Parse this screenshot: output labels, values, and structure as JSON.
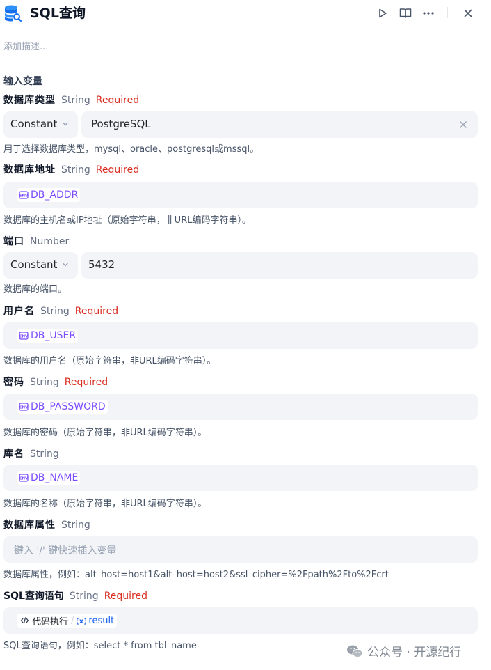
{
  "header": {
    "title": "SQL查询",
    "description_placeholder": "添加描述..."
  },
  "colors": {
    "accent": "#155eef",
    "required": "#d92d20",
    "env": "#7c4dff"
  },
  "section_title": "输入变量",
  "fields": {
    "db_type": {
      "name": "数据库类型",
      "type": "String",
      "required": "Required",
      "mode": "Constant",
      "value": "PostgreSQL",
      "help": "用于选择数据库类型，mysql、oracle、postgresql或mssql。"
    },
    "db_addr": {
      "name": "数据库地址",
      "type": "String",
      "required": "Required",
      "env_var": "DB_ADDR",
      "help": "数据库的主机名或IP地址（原始字符串，非URL编码字符串）。"
    },
    "port": {
      "name": "端口",
      "type": "Number",
      "mode": "Constant",
      "value": "5432",
      "help": "数据库的端口。"
    },
    "user": {
      "name": "用户名",
      "type": "String",
      "required": "Required",
      "env_var": "DB_USER",
      "help": "数据库的用户名（原始字符串，非URL编码字符串）。"
    },
    "password": {
      "name": "密码",
      "type": "String",
      "required": "Required",
      "env_var": "DB_PASSWORD",
      "help": "数据库的密码（原始字符串，非URL编码字符串）。"
    },
    "db_name": {
      "name": "库名",
      "type": "String",
      "env_var": "DB_NAME",
      "help": "数据库的名称（原始字符串，非URL编码字符串）。"
    },
    "db_props": {
      "name": "数据库属性",
      "type": "String",
      "placeholder": "键入 '/' 键快速插入变量",
      "help": "数据库属性，例如：alt_host=host1&alt_host=host2&ssl_cipher=%2Fpath%2Fto%2Fcrt"
    },
    "sql": {
      "name": "SQL查询语句",
      "type": "String",
      "required": "Required",
      "var_node": "代码执行",
      "var_name": "result",
      "help": "SQL查询语句，例如：select * from tbl_name"
    }
  },
  "watermark": "公众号 · 开源纪行"
}
